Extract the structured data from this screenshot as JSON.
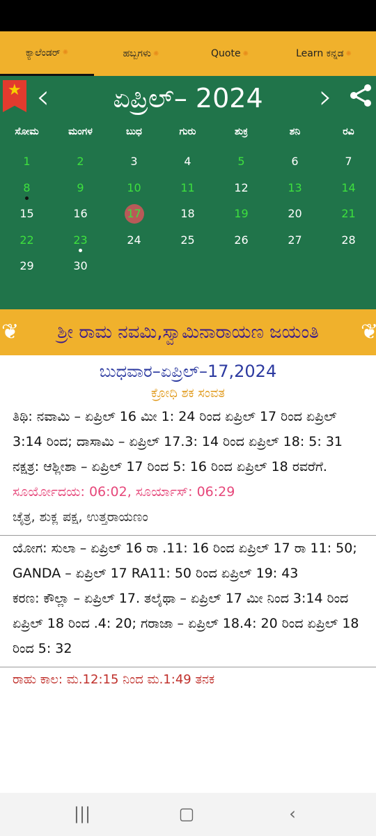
{
  "tabs": [
    {
      "label": "ಕ್ಯಾಲೆಂಡರ್",
      "active": true
    },
    {
      "label": "ಹಬ್ಬಗಳು",
      "active": false
    },
    {
      "label": "Quote",
      "active": false
    },
    {
      "label": "Learn ಕನ್ನಡ",
      "active": false
    }
  ],
  "calendar": {
    "month_title": "ಏಪ್ರಿಲ್– 2024",
    "prev_arrow": "‹",
    "next_arrow": "›",
    "weekdays": [
      "ಸೋಮ",
      "ಮಂಗಳ",
      "ಬುಧ",
      "ಗುರು",
      "ಶುಕ್ರ",
      "ಶನಿ",
      "ರವಿ"
    ],
    "days": [
      {
        "d": "1",
        "col": 0,
        "row": 0,
        "green": true
      },
      {
        "d": "2",
        "col": 1,
        "row": 0,
        "green": true
      },
      {
        "d": "3",
        "col": 2,
        "row": 0,
        "green": false
      },
      {
        "d": "4",
        "col": 3,
        "row": 0,
        "green": false
      },
      {
        "d": "5",
        "col": 4,
        "row": 0,
        "green": true
      },
      {
        "d": "6",
        "col": 5,
        "row": 0,
        "green": false
      },
      {
        "d": "7",
        "col": 6,
        "row": 0,
        "green": false
      },
      {
        "d": "8",
        "col": 0,
        "row": 1,
        "green": true,
        "dot": "#111111"
      },
      {
        "d": "9",
        "col": 1,
        "row": 1,
        "green": true
      },
      {
        "d": "10",
        "col": 2,
        "row": 1,
        "green": true
      },
      {
        "d": "11",
        "col": 3,
        "row": 1,
        "green": true
      },
      {
        "d": "12",
        "col": 4,
        "row": 1,
        "green": false
      },
      {
        "d": "13",
        "col": 5,
        "row": 1,
        "green": true
      },
      {
        "d": "14",
        "col": 6,
        "row": 1,
        "green": true
      },
      {
        "d": "15",
        "col": 0,
        "row": 2,
        "green": false
      },
      {
        "d": "16",
        "col": 1,
        "row": 2,
        "green": false
      },
      {
        "d": "17",
        "col": 2,
        "row": 2,
        "green": true,
        "today": true
      },
      {
        "d": "18",
        "col": 3,
        "row": 2,
        "green": false
      },
      {
        "d": "19",
        "col": 4,
        "row": 2,
        "green": true
      },
      {
        "d": "20",
        "col": 5,
        "row": 2,
        "green": false
      },
      {
        "d": "21",
        "col": 6,
        "row": 2,
        "green": true
      },
      {
        "d": "22",
        "col": 0,
        "row": 3,
        "green": true
      },
      {
        "d": "23",
        "col": 1,
        "row": 3,
        "green": true,
        "dot": "#ffffff"
      },
      {
        "d": "24",
        "col": 2,
        "row": 3,
        "green": false
      },
      {
        "d": "25",
        "col": 3,
        "row": 3,
        "green": false
      },
      {
        "d": "26",
        "col": 4,
        "row": 3,
        "green": false
      },
      {
        "d": "27",
        "col": 5,
        "row": 3,
        "green": false
      },
      {
        "d": "28",
        "col": 6,
        "row": 3,
        "green": false
      },
      {
        "d": "29",
        "col": 0,
        "row": 4,
        "green": false
      },
      {
        "d": "30",
        "col": 1,
        "row": 4,
        "green": false
      }
    ]
  },
  "festival": "ಶ್ರೀ ರಾಮ ನವಮಿ,ಸ್ವಾಮಿನಾರಾಯಣ ಜಯಂತಿ",
  "details": {
    "date_line": "ಬುಧವಾರ–ಏಪ್ರಿಲ್–17,2024",
    "samvat": "ಕ್ರೋಧಿ ಶಕ ಸಂವತ",
    "tithi": "ತಿಥಿ: ನವಾಮಿ – ಏಪ್ರಿಲ್ 16 ಮೀ 1: 24 ರಿಂದ ಏಪ್ರಿಲ್ 17 ರಿಂದ ಏಪ್ರಿಲ್ 3:14 ರಿಂದ; ದಾಸಾಮಿ – ಏಪ್ರಿಲ್ 17.3: 14 ರಿಂದ ಏಪ್ರಿಲ್ 18: 5: 31",
    "nakshatra": "ನಕ್ಷತ್ರ: ಆಶ್ಲೀಶಾ – ಏಪ್ರಿಲ್ 17 ರಿಂದ 5: 16 ರಿಂದ ಏಪ್ರಿಲ್ 18 ರವರೆಗೆ.",
    "sun": "ಸೂರ್ಯೋದಯ: 06:02, ಸೂರ್ಯಾಸ್: 06:29",
    "masa": "ಚೈತ್ರ, ಶುಕ್ಲ ಪಕ್ಷ, ಉತ್ತರಾಯಣಂ",
    "yoga": "ಯೋಗ: ಸುಲಾ – ಏಪ್ರಿಲ್ 16 ರಾ .11: 16 ರಿಂದ ಏಪ್ರಿಲ್ 17 ರಾ 11: 50; GANDA – ಏಪ್ರಿಲ್ 17 RA11: 50 ರಿಂದ ಏಪ್ರಿಲ್ 19: 43",
    "karana": "ಕರಣ: ಕೌಲ್ಲಾ – ಏಪ್ರಿಲ್ 17. ತಲೈಥಾ – ಏಪ್ರಿಲ್ 17 ಮೀ ನಿಂದ 3:14 ರಿಂದ ಏಪ್ರಿಲ್ 18 ರಿಂದ .4: 20; ಗರಾಜಾ – ಏಪ್ರಿಲ್ 18.4: 20 ರಿಂದ ಏಪ್ರಿಲ್ 18 ರಿಂದ 5: 32",
    "rahu": "ರಾಹು ಕಾಲ: ಮ.12:15 ನಿಂದ ಮ.1:49 ತನಕ"
  },
  "colors": {
    "tab_bar": "#f0b12c",
    "calendar_bg": "#20744a",
    "holiday_green": "#3ee03e",
    "today_circle": "#b85a58"
  }
}
